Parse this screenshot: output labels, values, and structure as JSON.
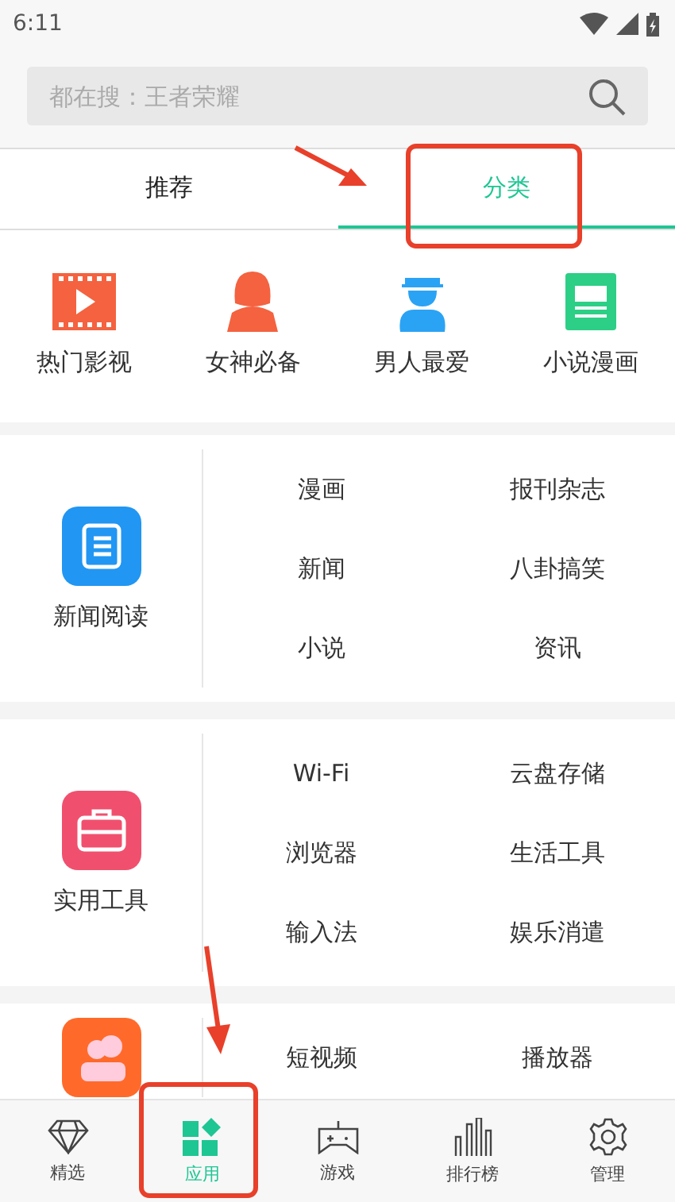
{
  "status_bar": {
    "time": "6:11"
  },
  "search": {
    "placeholder": "都在搜：王者荣耀"
  },
  "tabs": [
    {
      "label": "推荐",
      "selected": false
    },
    {
      "label": "分类",
      "selected": true
    }
  ],
  "quick_links": [
    {
      "label": "热门影视",
      "kind": "video"
    },
    {
      "label": "女神必备",
      "kind": "woman"
    },
    {
      "label": "男人最爱",
      "kind": "man"
    },
    {
      "label": "小说漫画",
      "kind": "book"
    }
  ],
  "sections": [
    {
      "label": "新闻阅读",
      "kind": "news",
      "items": [
        "漫画",
        "报刊杂志",
        "新闻",
        "八卦搞笑",
        "小说",
        "资讯"
      ]
    },
    {
      "label": "实用工具",
      "kind": "tools",
      "items": [
        "Wi-Fi",
        "云盘存储",
        "浏览器",
        "生活工具",
        "输入法",
        "娱乐消遣"
      ]
    },
    {
      "kind": "video",
      "items": [
        "短视频",
        "播放器"
      ]
    }
  ],
  "bottom_nav": [
    {
      "label": "精选",
      "kind": "diamond",
      "selected": false
    },
    {
      "label": "应用",
      "kind": "apps",
      "selected": true
    },
    {
      "label": "游戏",
      "kind": "gamepad",
      "selected": false
    },
    {
      "label": "排行榜",
      "kind": "bars",
      "selected": false
    },
    {
      "label": "管理",
      "kind": "gear",
      "selected": false
    }
  ]
}
